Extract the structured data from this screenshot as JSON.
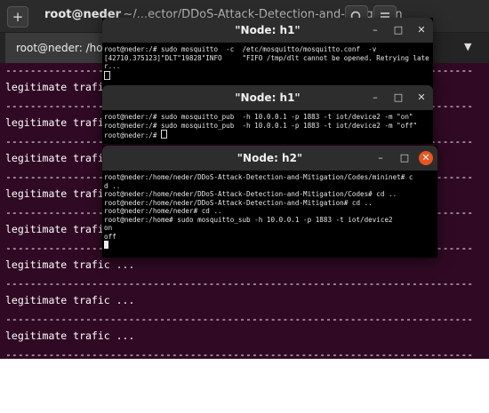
{
  "background_terminal": {
    "title": "root@neder",
    "title_tail": ": ~/...ector/DDoS-Attack-Detection-and-Mitigation",
    "tab_label": "root@neder: /hom",
    "new_tab_icon": "plus-in-box-icon",
    "search_icon": "search-icon",
    "menu_icon": "hamburger-menu-icon",
    "dropdown_icon": "chevron-down-icon",
    "dash_line": "----------------------------------------------------------------------------",
    "lines": [
      "legitimate trafic ...",
      "legitimate trafic ...",
      "legitimate trafic ...",
      "legitimate trafic ...",
      "legitimate trafic ...",
      "legitimate trafic ...",
      "legitimate trafic ...",
      "legitimate trafic ...",
      "legitimate trafic ...",
      "legitimate trafic ..."
    ]
  },
  "windows": {
    "h1_top": {
      "title": "\"Node: h1\"",
      "lines": [
        "root@neder:/# sudo mosquitto  -c  /etc/mosquitto/mosquitto.conf  -v",
        "[42710.375123]\"DLT\"19828\"INFO     \"FIFO /tmp/dlt cannot be opened. Retrying late",
        "r..."
      ]
    },
    "h1_mid": {
      "title": "\"Node: h1\"",
      "lines": [
        "root@neder:/# sudo mosquitto_pub  -h 10.0.0.1 -p 1883 -t iot/device2 -m \"on\"",
        "root@neder:/# sudo mosquitto_pub  -h 10.0.0.1 -p 1883 -t iot/device2 -m \"off\"",
        "root@neder:/# "
      ]
    },
    "h2": {
      "title": "\"Node: h2\"",
      "lines": [
        "root@neder:/home/neder/DDoS-Attack-Detection-and-Mitigation/Codes/mininet# c",
        "d ..",
        "root@neder:/home/neder/DDoS-Attack-Detection-and-Mitigation/Codes# cd ..",
        "root@neder:/home/neder/DDoS-Attack-Detection-and-Mitigation# cd ..",
        "root@neder:/home/neder# cd ..",
        "root@neder:/home# sudo mosquitto_sub -h 10.0.0.1 -p 1883 -t iot/device2",
        "on",
        "off"
      ]
    },
    "controls": {
      "minimize": "–",
      "maximize": "□",
      "close": "✕"
    }
  }
}
